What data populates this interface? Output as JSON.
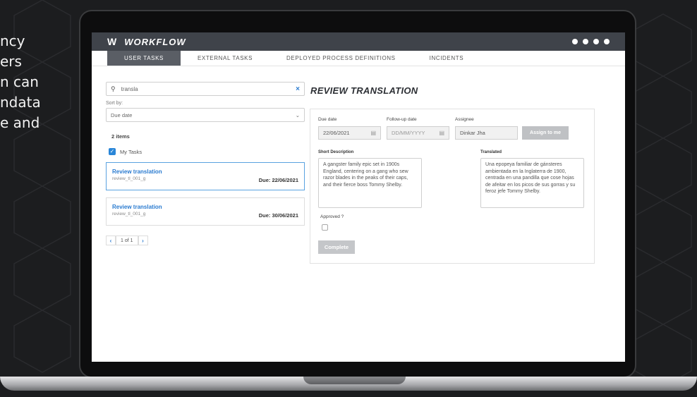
{
  "promo": {
    "lines": "ncy\ners\nn can\nndata\ne and"
  },
  "app": {
    "logo": "W",
    "name": "WORKFLOW"
  },
  "tabs": [
    {
      "label": "USER TASKS"
    },
    {
      "label": "EXTERNAL TASKS"
    },
    {
      "label": "DEPLOYED PROCESS DEFINITIONS"
    },
    {
      "label": "INCIDENTS"
    }
  ],
  "search": {
    "value": "transla",
    "clear": "×"
  },
  "sort": {
    "label": "Sort by:",
    "value": "Due date"
  },
  "list": {
    "count": "2 items",
    "filter_label": "My Tasks",
    "tasks": [
      {
        "title": "Review translation",
        "id": "review_tl_001_g",
        "due": "Due: 22/06/2021"
      },
      {
        "title": "Review translation",
        "id": "review_tl_001_g",
        "due": "Due: 30/06/2021"
      }
    ],
    "pager": "1 of 1"
  },
  "detail": {
    "title": "REVIEW TRANSLATION",
    "due_label": "Due date",
    "due_value": "22/06/2021",
    "followup_label": "Follow-up date",
    "followup_placeholder": "DD/MM/YYYY",
    "assignee_label": "Assignee",
    "assignee_value": "Dinkar Jha",
    "assign_button": "Assign to me",
    "short_desc_label": "Short Description",
    "short_desc": "A gangster family epic set in 1900s England, centering on a gang who sew razor blades in the peaks of their caps, and their fierce boss Tommy Shelby.",
    "translated_label": "Translated",
    "translated": "Una epopeya familiar de gánsteres ambientada en la Inglaterra de 1900, centrada en una pandilla que cose hojas de afeitar en los picos de sus gorras y su feroz jefe Tommy Shelby.",
    "approved_label": "Approved ?",
    "complete_button": "Complete"
  }
}
